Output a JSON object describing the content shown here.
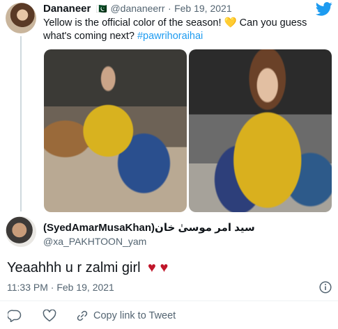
{
  "original_tweet": {
    "author_name": "Dananeer",
    "flag": "🇵🇰",
    "handle": "@dananeerr",
    "separator": "·",
    "date": "Feb 19, 2021",
    "text_line1_a": "Yellow is the official color of the season! ",
    "emoji_heart": "💛",
    "text_line1_b": " Can you guess",
    "text_line2_a": "what's coming next? ",
    "hashtag": "#pawrihoraihai"
  },
  "reply_tweet": {
    "author_name": "(SyedAmarMusaKhan)سید امر موسیٰ خان",
    "handle": "@xa_PAKHTOON_yam",
    "text": "Yeaahhh u r zalmi girl",
    "hearts": "♥ ♥",
    "timestamp": "11:33 PM · Feb 19, 2021"
  },
  "actions": {
    "copy_link": "Copy link to Tweet"
  },
  "colors": {
    "accent": "#1d9bf0",
    "heart": "#c0162a"
  },
  "icons": {
    "twitter": "twitter-bird-icon",
    "info": "info-icon",
    "reply": "reply-icon",
    "like": "heart-icon",
    "share": "link-icon"
  }
}
